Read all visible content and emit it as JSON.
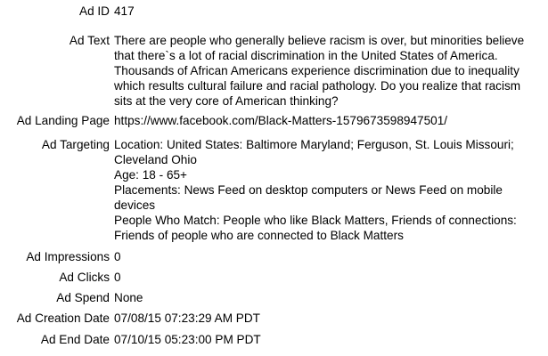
{
  "fields": {
    "ad_id": {
      "label": "Ad ID",
      "value": "417"
    },
    "ad_text": {
      "label": "Ad Text",
      "lines": [
        "There are people who generally believe racism is over, but minorities believe",
        "that there`s a lot of racial discrimination in the United States of America.",
        "Thousands of African Americans experience discrimination due to inequality",
        "which results cultural failure and racial pathology. Do you realize that racism",
        "sits at the very core of American thinking?"
      ]
    },
    "ad_landing_page": {
      "label": "Ad Landing Page",
      "value": "https://www.facebook.com/Black-Matters-1579673598947501/"
    },
    "ad_targeting": {
      "label": "Ad Targeting",
      "lines": [
        "Location: United States: Baltimore Maryland; Ferguson, St. Louis Missouri;",
        "Cleveland Ohio",
        "Age: 18 - 65+",
        "Placements: News Feed on desktop computers or News Feed on mobile",
        "devices",
        "People Who Match: People who like Black Matters, Friends of connections:",
        "Friends of people who are connected to Black Matters"
      ]
    },
    "ad_impressions": {
      "label": "Ad Impressions",
      "value": "0"
    },
    "ad_clicks": {
      "label": "Ad Clicks",
      "value": "0"
    },
    "ad_spend": {
      "label": "Ad Spend",
      "value": "None"
    },
    "ad_creation_date": {
      "label": "Ad Creation Date",
      "value": "07/08/15 07:23:29 AM PDT"
    },
    "ad_end_date": {
      "label": "Ad End Date",
      "value": "07/10/15 05:23:00 PM PDT"
    }
  }
}
